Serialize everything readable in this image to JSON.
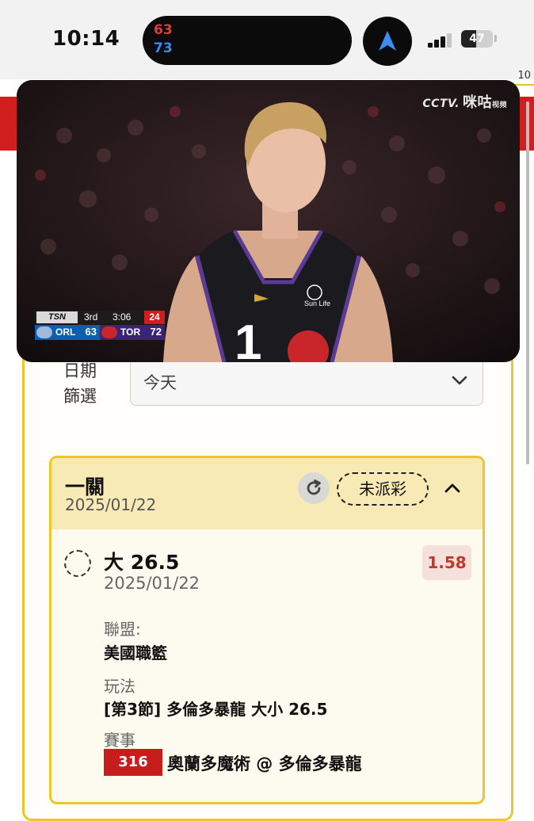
{
  "status_bar": {
    "time": "10:14",
    "live_activity": {
      "score_top": "63",
      "score_bottom": "73",
      "score_top_color": "#e23b3b",
      "score_bottom_color": "#2f8ef0"
    },
    "nav_icon": "navigation-arrow-icon",
    "signal_bars": 3,
    "battery_level": "47"
  },
  "background_app": {
    "corner_text": "10",
    "filter": {
      "label": "日期篩選",
      "selected": "今天"
    },
    "bet_card": {
      "bet_type": "一關",
      "date": "2025/01/22",
      "status": "未派彩",
      "selection": {
        "name": "大 26.5",
        "date": "2025/01/22",
        "odds": "1.58",
        "league_label": "聯盟:",
        "league_value": "美國職籃",
        "play_label": "玩法",
        "play_value": "[第3節] 多倫多暴龍 大小 26.5",
        "event_label": "賽事",
        "event_id": "316",
        "event_name": "奧蘭多魔術 @ 多倫多暴龍"
      }
    }
  },
  "video_pip": {
    "broadcaster": {
      "logo_text": "CCTV.",
      "channel": "咪咕",
      "tag": "视频"
    },
    "scoreboard": {
      "network": "TSN",
      "period": "3rd",
      "clock": "3:06",
      "shot_clock": "24",
      "team_a": {
        "abbr": "ORL",
        "score": "63"
      },
      "team_b": {
        "abbr": "TOR",
        "score": "72"
      }
    },
    "jersey_number": "1",
    "jersey_sponsor": "Sun Life"
  },
  "colors": {
    "accent_gold": "#efc62a",
    "brand_red": "#d11f1f",
    "odds_red": "#c0392b",
    "magic_blue": "#0b5fb0",
    "raptors_purple": "#3b2377"
  }
}
